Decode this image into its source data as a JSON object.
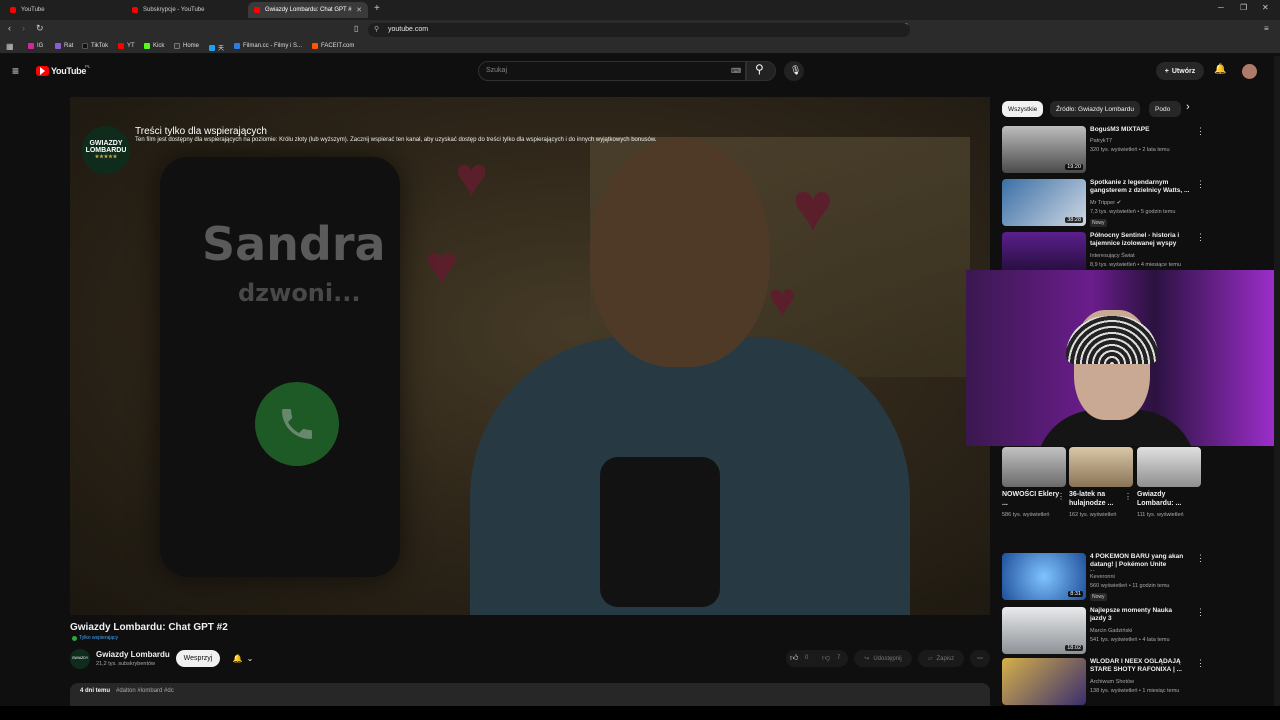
{
  "browser": {
    "tabs": [
      {
        "title": "YouTube",
        "active": false
      },
      {
        "title": "Subskrypcje - YouTube",
        "active": false
      },
      {
        "title": "Gwiazdy Lombardu: Chat GPT #",
        "active": true
      }
    ],
    "new_tab": "+",
    "url": "youtube.com",
    "window_controls": {
      "minimize": "─",
      "restore": "❐",
      "close": "✕"
    },
    "bookmarks": [
      {
        "label": "IG",
        "color": "#d6249f"
      },
      {
        "label": "Rat",
        "color": "#8c5bd6"
      },
      {
        "label": "TikTok",
        "color": "#111111"
      },
      {
        "label": "YT",
        "color": "#ff0000"
      },
      {
        "label": "Kick",
        "color": "#53fc18"
      },
      {
        "label": "Home",
        "color": "#333333"
      },
      {
        "label": "天",
        "color": "#1da1f2"
      },
      {
        "label": "Filman.cc - Filmy i S...",
        "color": "#2a7de1"
      },
      {
        "label": "FACEIT.com",
        "color": "#ff5500"
      }
    ]
  },
  "header": {
    "logo_text": "YouTube",
    "logo_country": "PL",
    "search_placeholder": "Szukaj",
    "create_label": "Utwórz"
  },
  "player": {
    "phone_caller": "Sandra",
    "phone_calling": "dzwoni...",
    "channel_logo_line1": "GWIAZDY",
    "channel_logo_line2": "LOMBARDU",
    "channel_logo_stars": "★★★★★",
    "members_title": "Treści tylko dla wspierających",
    "members_desc": "Ten film jest dostępny dla wspierających na poziomie: Królu złoty (lub wyższym). Zacznij wspierać ten kanał, aby uzyskać dostęp do treści tylko dla wspierających i do innych wyjątkowych bonusów."
  },
  "video": {
    "title": "Gwiazdy Lombardu: Chat GPT #2",
    "members_badge": "Tylko wspierający",
    "channel_name": "Gwiazdy Lombardu",
    "subscribers": "21,2 tys. subskrybentów",
    "join_label": "Wesprzyj",
    "likes": "0",
    "dislikes": "7",
    "share_label": "Udostępnij",
    "save_label": "Zapisz",
    "more_label": "⋯",
    "date": "4 dni temu",
    "tags": "#dalton #lombard #dc"
  },
  "sidebar": {
    "chips": [
      {
        "label": "Wszystkie",
        "active": true
      },
      {
        "label": "Źródło: Gwiazdy Lombardu",
        "active": false
      },
      {
        "label": "Podo",
        "active": false
      }
    ],
    "recommendations_top": [
      {
        "title": "BoguśM3 MIXTAPE",
        "channel": "PatrykT7",
        "meta": "320 tys. wyświetleń • 2 lata temu",
        "duration": "19:20",
        "badge": "",
        "thumb": "#6d6d6d"
      },
      {
        "title": "Spotkanie z legendarnym gangsterem z dzielnicy Watts, ...",
        "channel": "Mr Tripper ✔",
        "meta": "7,3 tys. wyświetleń • 5 godzin temu",
        "duration": "38:28",
        "badge": "Nowy",
        "thumb": "#4a6a8a"
      },
      {
        "title": "Północny Sentinel - historia i tajemnice izolowanej wyspy",
        "channel": "Interesujący Świat",
        "meta": "8,9 tys. wyświetleń • 4 miesiące temu",
        "duration": "",
        "badge": "",
        "thumb": "#5a1f8c"
      }
    ],
    "shorts": [
      {
        "title": "NOWOŚCI Eklery ...",
        "views": "586 tys. wyświetleń",
        "thumb": "#7f7f7f"
      },
      {
        "title": "36-latek na hulajnodze ...",
        "views": "162 tys. wyświetleń",
        "thumb": "#a08a6a"
      },
      {
        "title": "Gwiazdy Lombardu: ...",
        "views": "111 tys. wyświetleń",
        "thumb": "#9a9a9a"
      }
    ],
    "recommendations_bottom": [
      {
        "title": "4 POKEMON BARU yang akan datang! | Pokémon Unite News...",
        "channel": "Keveronni",
        "meta": "560 wyświetleń • 11 godzin temu",
        "duration": "8:31",
        "badge": "Nowy",
        "thumb": "#2a6fb8"
      },
      {
        "title": "Najlepsze momenty Nauka jazdy 3",
        "channel": "Marcin Gadziński",
        "meta": "541 tys. wyświetleń • 4 lata temu",
        "duration": "18:02",
        "badge": "",
        "thumb": "#b9bcc0"
      },
      {
        "title": "WLODAR I NEEX OGLĄDAJĄ STARE SHOTY RAFONIXA | ...",
        "channel": "Archiwum Shotów",
        "meta": "138 tys. wyświetleń • 1 miesiąc temu",
        "duration": "",
        "badge": "",
        "thumb": "#3a2e6e"
      }
    ]
  },
  "colors": {
    "accent": "#ff0000",
    "link": "#3ea6ff",
    "members_green": "#2ba640"
  }
}
